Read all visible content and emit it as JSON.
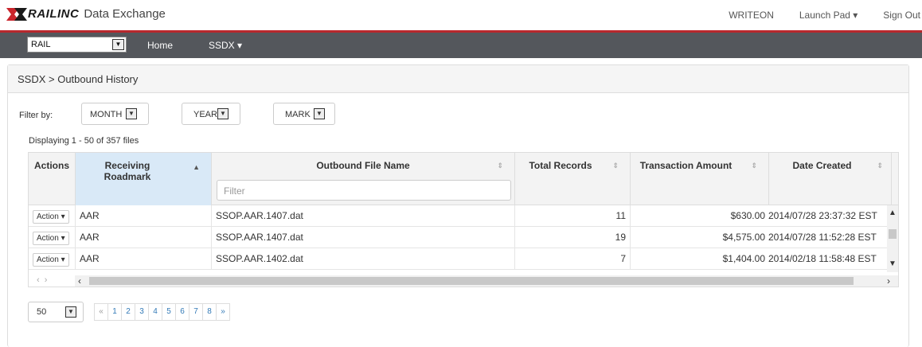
{
  "header": {
    "brand": "RAILINC",
    "product": "Data Exchange",
    "user": "WRITEON",
    "launch_pad": "Launch Pad ▾",
    "sign_out": "Sign Out"
  },
  "nav": {
    "rail_select": "RAIL",
    "home": "Home",
    "ssdx": "SSDX ▾"
  },
  "panel": {
    "breadcrumb": "SSDX > Outbound History",
    "filter_label": "Filter by:",
    "month": "MONTH",
    "year": "YEAR",
    "mark": "MARK",
    "displaying": "Displaying 1 - 50 of 357 files"
  },
  "table": {
    "columns": [
      "Actions",
      "Receiving Roadmark",
      "Outbound File Name",
      "Total Records",
      "Transaction Amount",
      "Date Created"
    ],
    "filter_placeholder": "Filter",
    "rows": [
      {
        "action": "Action ▾",
        "roadmark": "AAR",
        "file": "SSOP.AAR.1407.dat",
        "records": "11",
        "amount": "$630.00",
        "date": "2014/07/28 23:37:32 EST"
      },
      {
        "action": "Action ▾",
        "roadmark": "AAR",
        "file": "SSOP.AAR.1407.dat",
        "records": "19",
        "amount": "$4,575.00",
        "date": "2014/07/28 11:52:28 EST"
      },
      {
        "action": "Action ▾",
        "roadmark": "AAR",
        "file": "SSOP.AAR.1402.dat",
        "records": "7",
        "amount": "$1,404.00",
        "date": "2014/02/18 11:58:48 EST"
      }
    ]
  },
  "pagination": {
    "page_size": "50",
    "first": "«",
    "pages": [
      "1",
      "2",
      "3",
      "4",
      "5",
      "6",
      "7",
      "8"
    ],
    "next": "»"
  },
  "colors": {
    "accent_red": "#b8282d",
    "navbar": "#54575c",
    "sorted_header": "#d9e9f7",
    "link": "#337ab7"
  }
}
